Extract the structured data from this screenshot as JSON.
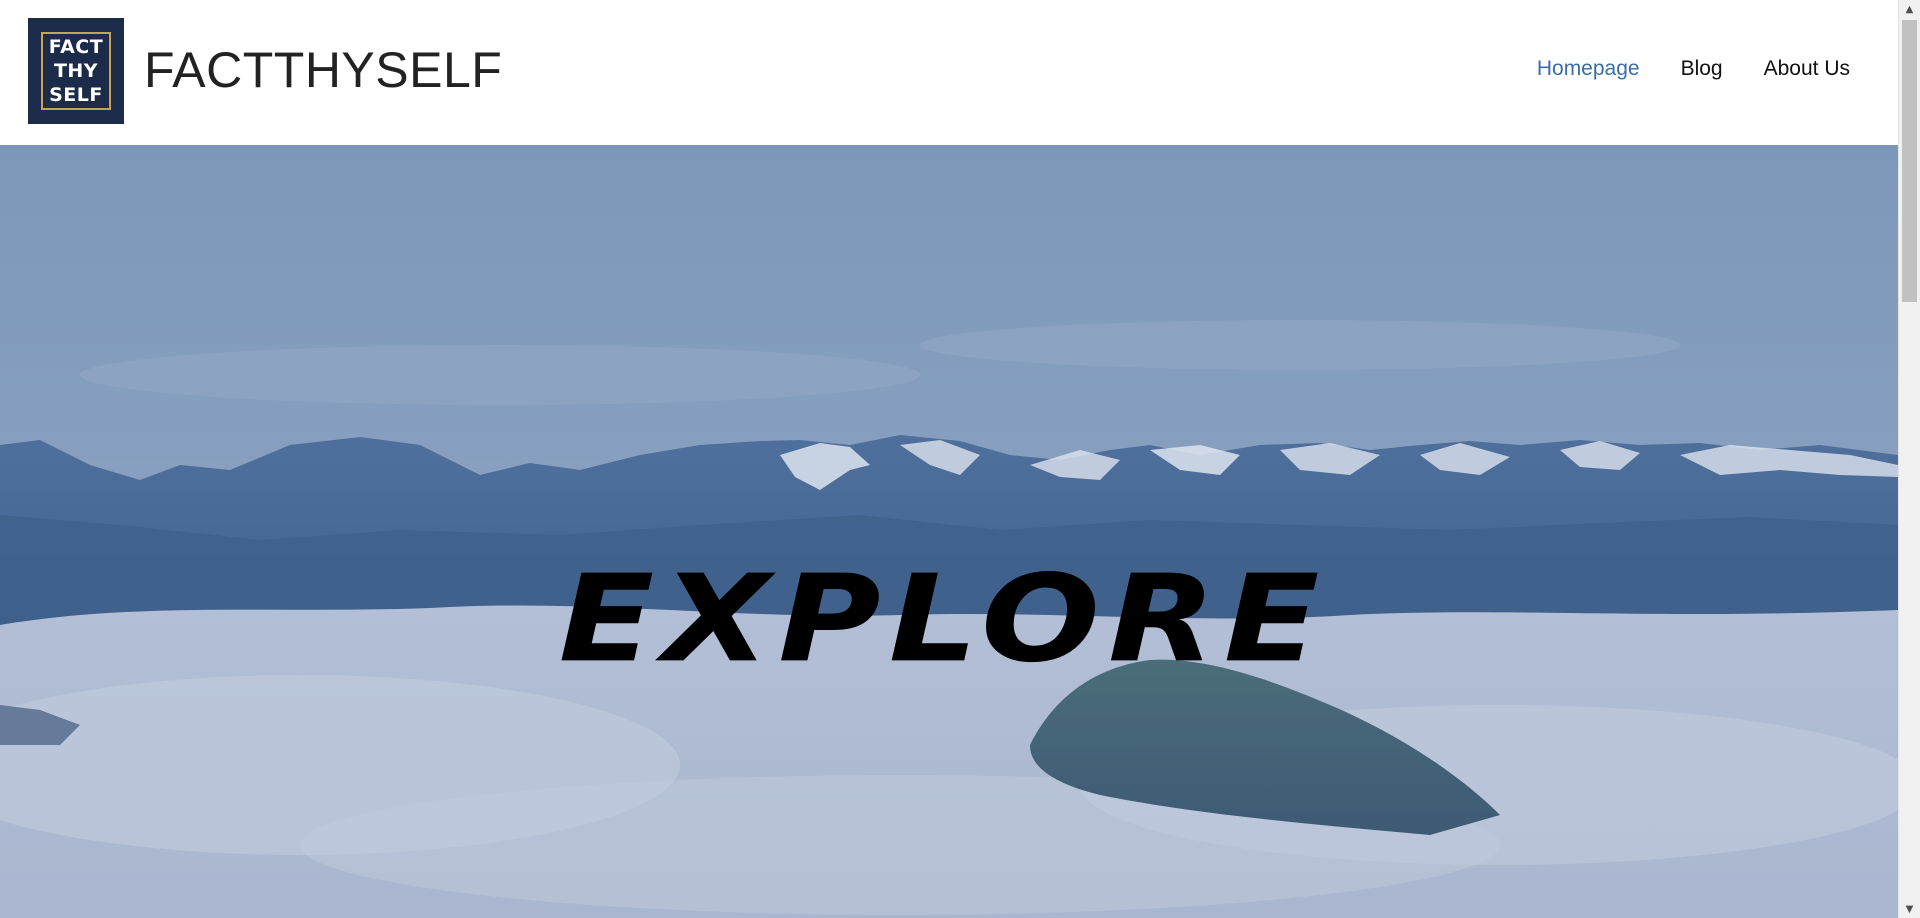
{
  "header": {
    "logo_lines": [
      "FACT",
      "THY",
      "SELF"
    ],
    "site_title": "FACTTHYSELF",
    "nav": [
      {
        "label": "Homepage",
        "active": true
      },
      {
        "label": "Blog",
        "active": false
      },
      {
        "label": "About Us",
        "active": false
      }
    ]
  },
  "hero": {
    "title": "EXPLORE"
  },
  "colors": {
    "logo_bg": "#1c2b49",
    "logo_border": "#c9a34e",
    "nav_active": "#3a6ea8",
    "text": "#111111"
  }
}
